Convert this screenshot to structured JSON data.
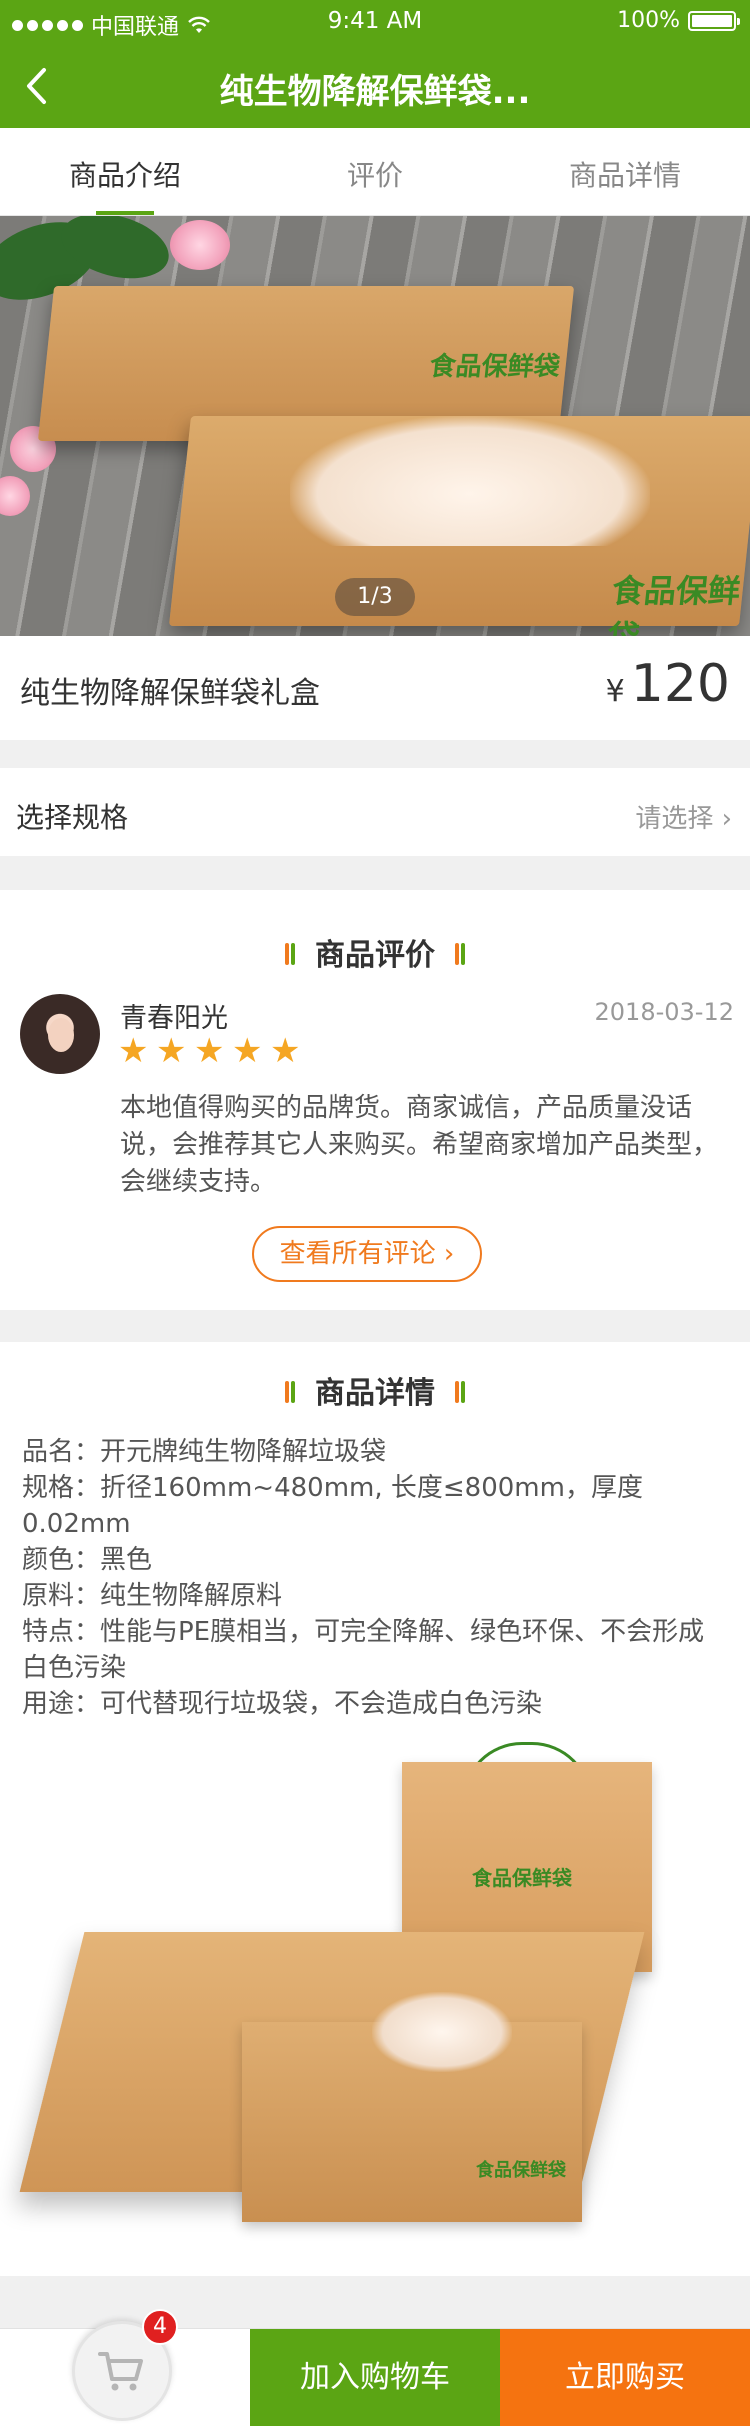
{
  "status_bar": {
    "carrier": "中国联通",
    "time": "9:41 AM",
    "battery": "100%"
  },
  "nav": {
    "title": "纯生物降解保鲜袋..."
  },
  "tabs": [
    {
      "label": "商品介绍",
      "active": true
    },
    {
      "label": "评价",
      "active": false
    },
    {
      "label": "商品详情",
      "active": false
    }
  ],
  "gallery": {
    "pager": "1/3",
    "brand_text": "食品保鲜袋"
  },
  "product": {
    "name": "纯生物降解保鲜袋礼盒",
    "currency": "¥",
    "price": "120"
  },
  "spec": {
    "label": "选择规格",
    "placeholder": "请选择 ›"
  },
  "reviews": {
    "heading": "商品评价",
    "items": [
      {
        "user": "青春阳光",
        "date": "2018-03-12",
        "rating": 5,
        "text": "本地值得购买的品牌货。商家诚信，产品质量没话说，会推荐其它人来购买。希望商家增加产品类型，会继续支持。"
      }
    ],
    "view_all": "查看所有评论 ›"
  },
  "details": {
    "heading": "商品详情",
    "lines": [
      "品名：开元牌纯生物降解垃圾袋",
      "规格：折径160mm~480mm, 长度≤800mm，厚度0.02mm",
      "颜色：黑色",
      "原料：纯生物降解原料",
      "特点：性能与PE膜相当，可完全降解、绿色环保、不会形成白色污染",
      "用途：可代替现行垃圾袋，不会造成白色污染"
    ],
    "image_brand_text": "食品保鲜袋"
  },
  "bottom_bar": {
    "cart_count": "4",
    "add_to_cart": "加入购物车",
    "buy_now": "立即购买"
  },
  "colors": {
    "brand_green": "#5ba514",
    "accent_orange": "#f57310",
    "star": "#f5a623",
    "badge_red": "#e02020"
  }
}
